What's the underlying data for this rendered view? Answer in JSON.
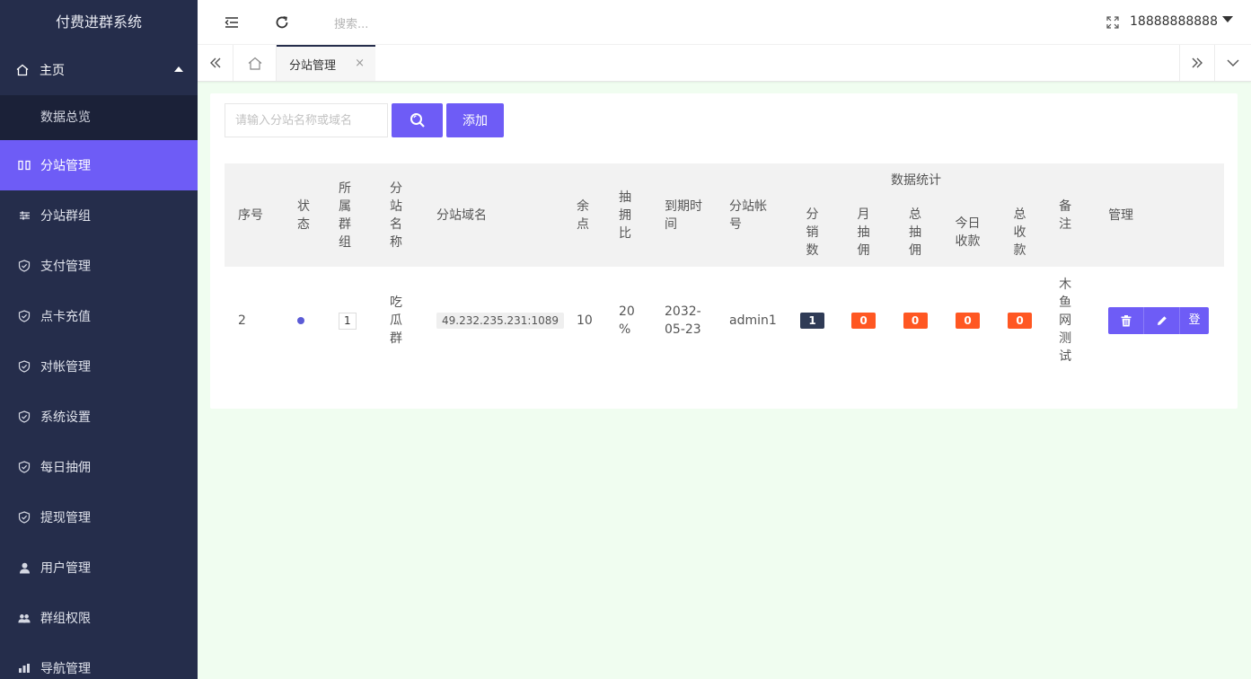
{
  "sidebar": {
    "logo": "付费进群系统",
    "home": {
      "label": "主页",
      "icon": "home-icon"
    },
    "sub_items": [
      {
        "label": "数据总览"
      }
    ],
    "items": [
      {
        "label": "分站管理",
        "icon": "columns-icon",
        "active": true
      },
      {
        "label": "分站群组",
        "icon": "sliders-icon"
      },
      {
        "label": "支付管理",
        "icon": "shield-check-icon"
      },
      {
        "label": "点卡充值",
        "icon": "shield-check-icon"
      },
      {
        "label": "对帐管理",
        "icon": "shield-check-icon"
      },
      {
        "label": "系统设置",
        "icon": "shield-check-icon"
      },
      {
        "label": "每日抽佣",
        "icon": "shield-check-icon"
      },
      {
        "label": "提现管理",
        "icon": "shield-check-icon"
      },
      {
        "label": "用户管理",
        "icon": "user-icon"
      },
      {
        "label": "群组权限",
        "icon": "users-icon"
      },
      {
        "label": "导航管理",
        "icon": "bar-chart-icon"
      }
    ]
  },
  "header": {
    "search_placeholder": "搜索...",
    "username": "18888888888"
  },
  "tabs": {
    "active": {
      "label": "分站管理",
      "close": "×"
    }
  },
  "toolbar": {
    "search_placeholder": "请输入分站名称或域名",
    "add_label": "添加"
  },
  "table": {
    "group_header": "数据统计",
    "headers": {
      "index": "序号",
      "status": "状态",
      "group": [
        "所",
        "属",
        "群",
        "组"
      ],
      "name": [
        "分",
        "站",
        "名",
        "称"
      ],
      "domain": "分站域名",
      "balance": [
        "余",
        "点"
      ],
      "commission": [
        "抽",
        "拥",
        "比"
      ],
      "expire": [
        "到期时",
        "间"
      ],
      "account": [
        "分站帐",
        "号"
      ],
      "sales": [
        "分",
        "销",
        "数"
      ],
      "monthly": [
        "月",
        "抽",
        "佣"
      ],
      "total_comm": [
        "总",
        "抽",
        "佣"
      ],
      "today_income": [
        "今日",
        "收款"
      ],
      "total_income": [
        "总",
        "收",
        "款"
      ],
      "remark": [
        "备",
        "注"
      ],
      "manage": "管理"
    },
    "rows": [
      {
        "index": "2",
        "status_color": "#5b5bd6",
        "group": "1",
        "name": [
          "吃",
          "瓜",
          "群"
        ],
        "domain": "49.232.235.231:1089",
        "balance": "10",
        "commission": [
          "20",
          "%"
        ],
        "expire": [
          "2032-",
          "05-23"
        ],
        "account": "admin1",
        "sales": "1",
        "monthly": "0",
        "total_comm": "0",
        "today_income": "0",
        "total_income": "0",
        "remark": [
          "木",
          "鱼",
          "网",
          "测",
          "试"
        ],
        "actions": {
          "delete_icon": "trash-icon",
          "edit_icon": "pencil-icon",
          "login_label": "登"
        }
      }
    ]
  },
  "colors": {
    "sidebar_bg": "#252d4b",
    "accent": "#6e5cf6",
    "badge_dark": "#2f3b56",
    "badge_orange": "#ff5722",
    "page_bg": "#f0fdf0"
  }
}
